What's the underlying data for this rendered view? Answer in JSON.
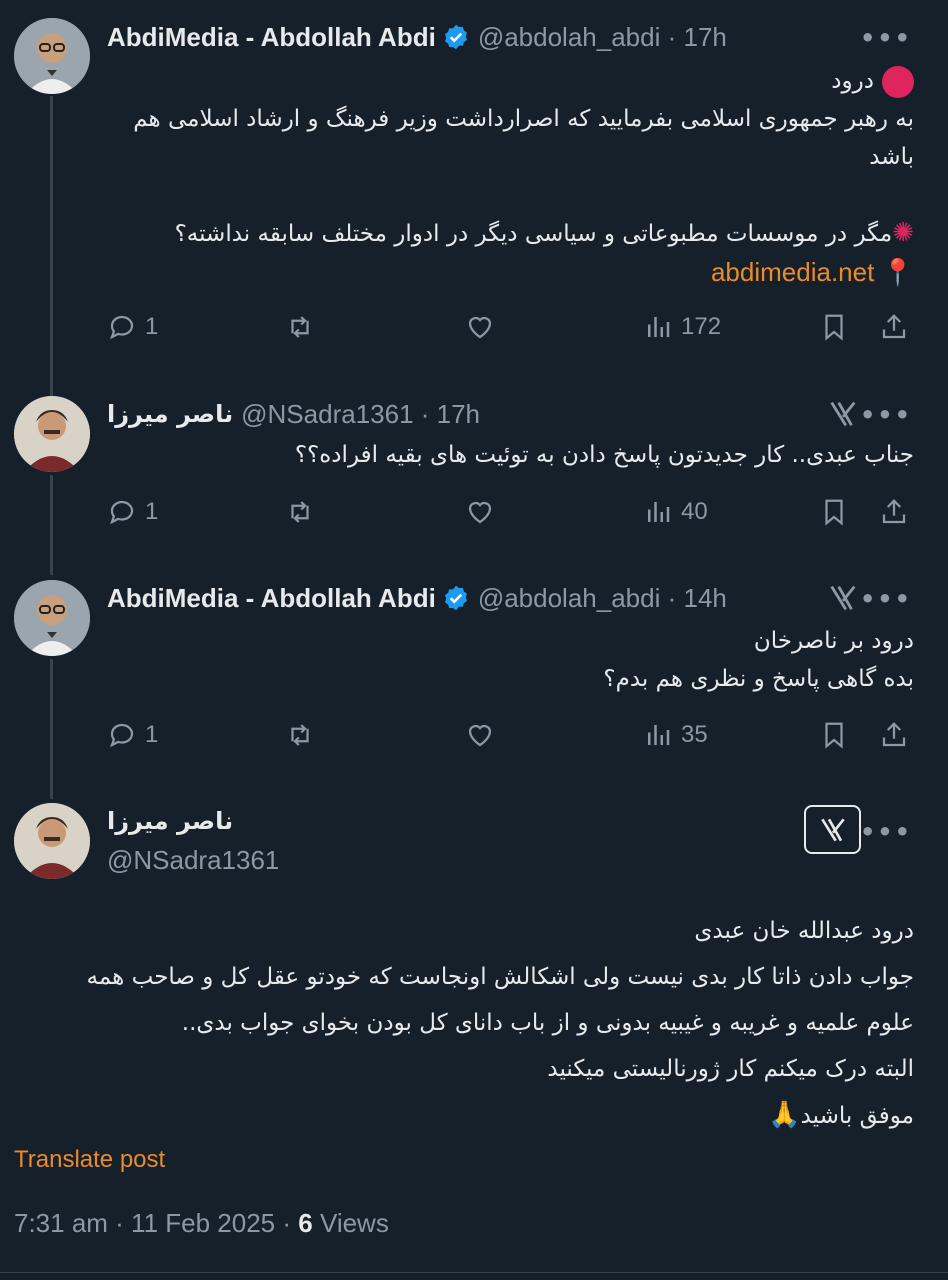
{
  "tweets": [
    {
      "name": "AbdiMedia - Abdollah Abdi",
      "handle": "@abdolah_abdi · 17h",
      "verified": true,
      "lines": [
        "درود",
        "به رهبر جمهوری اسلامی بفرمایید که اصرارداشت وزیر فرهنگ و ارشاد اسلامی هم",
        "باشد",
        "",
        "مگر در موسسات مطبوعاتی و سیاسی دیگر در ادوار مختلف سابقه نداشته؟",
        "abdimedia.net"
      ],
      "replies": "1",
      "views": "172"
    },
    {
      "name": "ناصر میرزا",
      "handle": "@NSadra1361 · 17h",
      "lines": [
        "جناب عبدی.. کار جدیدتون پاسخ دادن به توئیت های بقیه افراده؟؟"
      ],
      "replies": "1",
      "views": "40"
    },
    {
      "name": "AbdiMedia - Abdollah Abdi",
      "handle": "@abdolah_abdi · 14h",
      "verified": true,
      "lines": [
        "درود بر ناصرخان",
        "بده گاهی پاسخ و نظری هم بدم؟"
      ],
      "replies": "1",
      "views": "35"
    },
    {
      "name": "ناصر میرزا",
      "handle": "@NSadra1361",
      "lines": [
        "درود عبدالله خان عبدی",
        "جواب دادن ذاتا کار بدی نیست ولی اشکالش اونجاست که  خودتو عقل کل و صاحب همه",
        "علوم علمیه و غریبه و  غیبیه بدونی و از باب دانای کل بودن بخوای جواب بدی..",
        "البته درک میکنم کار ژورنالیستی میکنید",
        "موفق باشید"
      ]
    }
  ],
  "translate_label": "Translate post",
  "meta": {
    "time_date": "7:31 am · 11 Feb 2025 · ",
    "views_count": "6",
    "views_label": " Views"
  },
  "colors": {
    "background": "#15202b",
    "accent": "#e98b2b",
    "muted": "#8b98a5",
    "verified": "#1d9bf0"
  }
}
